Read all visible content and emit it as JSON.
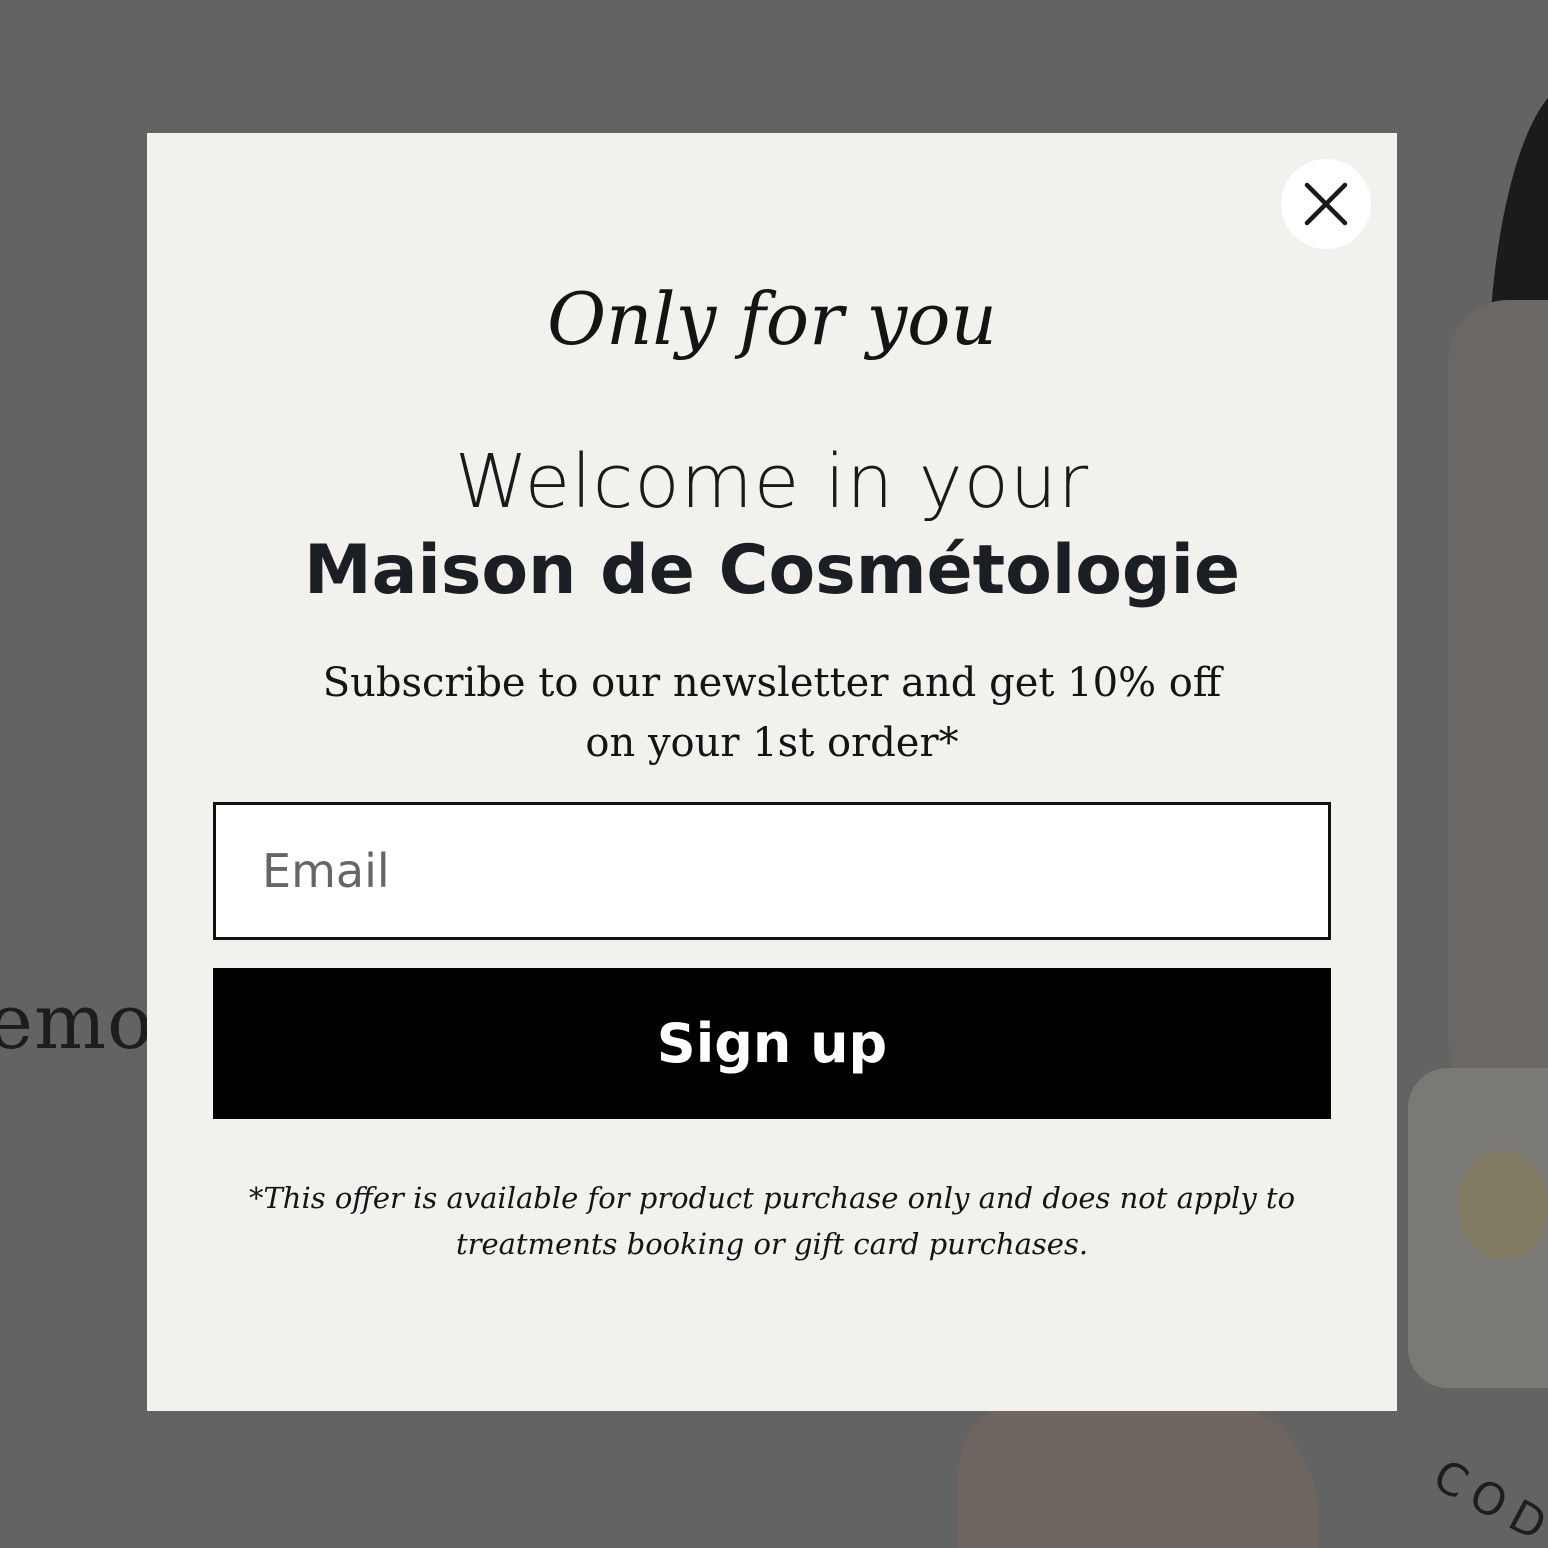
{
  "background": {
    "text_fragment": "emov",
    "jar_label": "COD"
  },
  "modal": {
    "close_icon": "close-icon",
    "eyebrow": "Only for you",
    "welcome": "Welcome in your",
    "brand": "Maison de Cosmétologie",
    "subtitle": "Subscribe to our newsletter and get 10% off on your 1st order*",
    "email": {
      "placeholder": "Email",
      "value": ""
    },
    "signup_label": "Sign up",
    "disclaimer": "*This offer is available for product purchase only and does not apply to treatments booking or gift card purchases."
  },
  "colors": {
    "overlay": "#636363",
    "modal_bg": "#f3f1ee",
    "button_bg": "#000000",
    "button_text": "#ffffff",
    "text": "#141414"
  }
}
